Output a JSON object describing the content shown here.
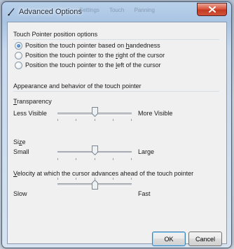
{
  "window": {
    "title": "Advanced Options",
    "background_tabs": [
      "Settings",
      "Touch",
      "Panning"
    ],
    "accent_color": "#c23b22"
  },
  "position_group": {
    "title": "Touch Pointer position options",
    "options": [
      {
        "pre": "Position the touch pointer based on ",
        "key": "h",
        "post": "andedness",
        "checked": true
      },
      {
        "pre": "Position the touch pointer to the ",
        "key": "r",
        "post": "ight of the cursor",
        "checked": false
      },
      {
        "pre": "Position the touch pointer to the ",
        "key": "l",
        "post": "eft of the cursor",
        "checked": false
      }
    ]
  },
  "appearance_group": {
    "title": "Appearance and behavior of the touch pointer",
    "transparency": {
      "key": "T",
      "rest": "ransparency",
      "min_label": "Less Visible",
      "max_label": "More Visible",
      "value": 0.5
    },
    "size": {
      "pre": "Si",
      "key": "z",
      "post": "e",
      "min_label": "Small",
      "max_label": "Large",
      "value": 0.5
    },
    "velocity": {
      "key": "V",
      "rest": "elocity at which the cursor advances ahead of the touch pointer",
      "min_label": "Slow",
      "max_label": "Fast",
      "value": 0.5
    }
  },
  "buttons": {
    "ok": "OK",
    "cancel": "Cancel"
  }
}
